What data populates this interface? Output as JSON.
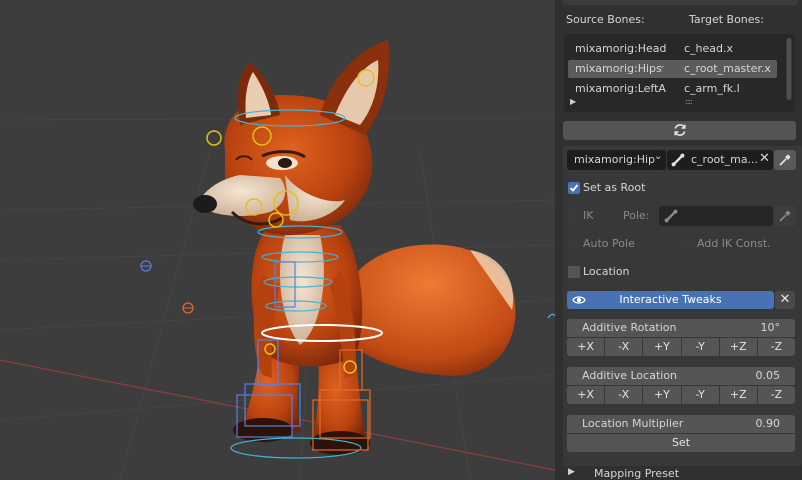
{
  "viewport": {
    "label": "3D Viewport"
  },
  "panel": {
    "headers": {
      "source": "Source Bones:",
      "target": "Target Bones:"
    },
    "mapping_rows": [
      {
        "source": "mixamorig:Head",
        "target": "c_head.x",
        "selected": false
      },
      {
        "source": "mixamorig:Hips",
        "target": "c_root_master.x",
        "selected": true
      },
      {
        "source": "mixamorig:LeftA...",
        "target": "c_arm_fk.l",
        "selected": false
      }
    ],
    "expand_arrow": "▶",
    "drag_handle": "::::",
    "source_select": "mixamorig:Hip",
    "target_field": "c_root_ma...",
    "set_as_root": {
      "label": "Set as Root",
      "checked": true
    },
    "ik": {
      "label": "IK",
      "checked": false
    },
    "pole_label": "Pole:",
    "auto_pole": {
      "label": "Auto Pole",
      "checked": false
    },
    "add_ik_const": {
      "label": "Add IK Const.",
      "checked": false
    },
    "location": {
      "label": "Location",
      "checked": false
    },
    "interactive_tweaks": "Interactive Tweaks",
    "additive_rotation": {
      "label": "Additive Rotation",
      "value": "10°"
    },
    "rotation_buttons": [
      "+X",
      "-X",
      "+Y",
      "-Y",
      "+Z",
      "-Z"
    ],
    "additive_location": {
      "label": "Additive Location",
      "value": "0.05"
    },
    "location_buttons": [
      "+X",
      "-X",
      "+Y",
      "-Y",
      "+Z",
      "-Z"
    ],
    "location_multiplier": {
      "label": "Location Multiplier",
      "value": "0.90"
    },
    "set_button": "Set",
    "mapping_preset": "Mapping Preset",
    "colors": {
      "accent": "#4772b3",
      "panel_bg": "#303030",
      "field_bg": "#1d1d1d"
    }
  }
}
